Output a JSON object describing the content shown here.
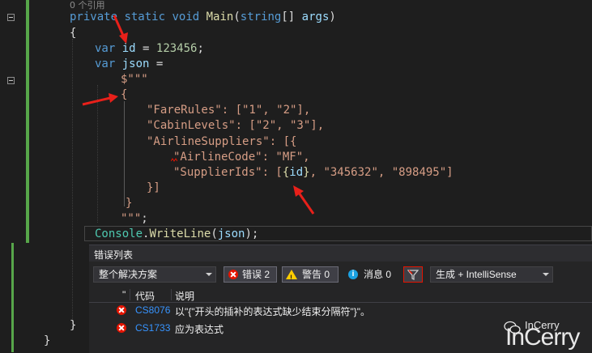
{
  "editor": {
    "references": "0 个引用",
    "lines": {
      "sig_private": "private",
      "sig_static": "static",
      "sig_void": "void",
      "sig_main": "Main",
      "sig_open": "(",
      "sig_string": "string",
      "sig_arr": "[] ",
      "sig_args": "args",
      "sig_close": ")",
      "brace_open": "{",
      "var1_kw": "var",
      "var1_name": "id",
      "var1_eq": " = ",
      "var1_num": "123456",
      "var1_semi": ";",
      "var2_kw": "var",
      "var2_name": "json",
      "var2_eq": " =",
      "raw_open": "$\"\"\"",
      "json_open": "{",
      "fare": "\"FareRules\": [\"1\", \"2\"],",
      "cabin": "\"CabinLevels\": [\"2\", \"3\"],",
      "airline": "\"AirlineSuppliers\": [{",
      "airline_code": "\"AirlineCode\": \"MF\",",
      "supplier_pre": "\"SupplierIds\": [",
      "supplier_interp_open": "{",
      "supplier_interp_id": "id",
      "supplier_interp_close": "}",
      "supplier_post": ", \"345632\", \"898495\"]",
      "close_arr": "}]",
      "json_close": "}",
      "raw_close": "\"\"\"",
      "raw_semi": ";",
      "console_cls": "Console",
      "console_dot": ".",
      "console_fn": "WriteLine",
      "console_open": "(",
      "console_arg": "json",
      "console_close": ");",
      "brace_close_inner": "}",
      "brace_close_outer": "}"
    }
  },
  "error_list": {
    "title": "错误列表",
    "scope": "整个解决方案",
    "errors_label": "错误 2",
    "warnings_label": "警告 0",
    "messages_label": "消息 0",
    "build_filter": "生成 + IntelliSense",
    "columns": {
      "marker": "\"",
      "code": "代码",
      "description": "说明"
    },
    "rows": [
      {
        "code": "CS8076",
        "description": "以\"{\"开头的插补的表达式缺少结束分隔符\"}\"。"
      },
      {
        "code": "CS1733",
        "description": "应为表达式"
      }
    ]
  },
  "watermark": {
    "brand_small": "InCerry",
    "brand_large": "InCerry"
  },
  "colors": {
    "background": "#1e1e1e",
    "keyword": "#569cd6",
    "string": "#d69d85",
    "method": "#dcdcaa",
    "type": "#4ec9b0",
    "variable": "#9cdcfe",
    "number": "#b5cea8",
    "error": "#e51400",
    "arrow": "#e8201a",
    "change_bar": "#57a64a"
  }
}
